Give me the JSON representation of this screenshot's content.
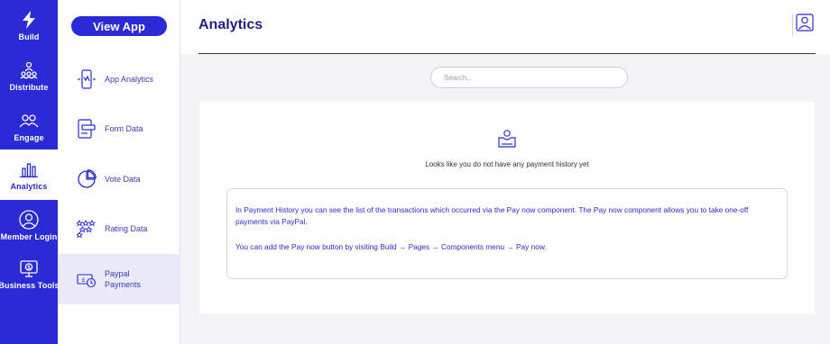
{
  "rail": {
    "items": [
      {
        "label": "Build",
        "icon": "lightning-icon"
      },
      {
        "label": "Distribute",
        "icon": "distribute-icon"
      },
      {
        "label": "Engage",
        "icon": "engage-icon"
      },
      {
        "label": "Analytics",
        "icon": "bar-chart-icon",
        "active": true
      },
      {
        "label": "Member Login",
        "icon": "user-circle-icon"
      },
      {
        "label": "Business Tools",
        "icon": "business-tools-icon"
      }
    ]
  },
  "sidebar": {
    "view_app_label": "View App",
    "items": [
      {
        "label": "App Analytics",
        "icon": "phone-analytics-icon"
      },
      {
        "label": "Form Data",
        "icon": "form-icon"
      },
      {
        "label": "Vote Data",
        "icon": "pie-chart-icon"
      },
      {
        "label": "Rating Data",
        "icon": "stars-icon"
      },
      {
        "label": "Paypal Payments",
        "icon": "payments-icon",
        "selected": true
      }
    ]
  },
  "header": {
    "title": "Analytics",
    "profile_icon": "profile-icon"
  },
  "search": {
    "placeholder": "Search..."
  },
  "main": {
    "empty_icon": "empty-inbox-icon",
    "empty_text": "Looks like you do not have any payment history yet",
    "info_paragraph_1": "In Payment History you can see the list of the transactions which occurred via the Pay now component. The Pay now component allows you to take one-off payments via PayPal.",
    "info_paragraph_2": "You can add the Pay now button by visiting Build → Pages → Components menu → Pay now."
  },
  "colors": {
    "brand_blue": "#2a2ad6",
    "title_navy": "#1f1f8a",
    "selected_bg": "#e9ebfb"
  }
}
